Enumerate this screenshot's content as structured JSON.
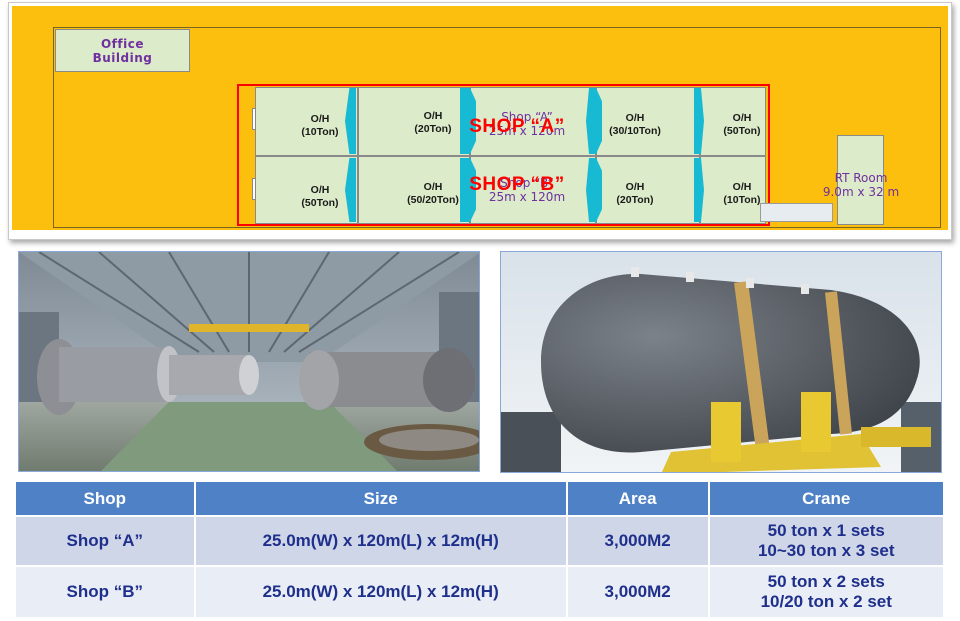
{
  "plan": {
    "office": {
      "line1": "Office",
      "line2": "Building"
    },
    "top_row": [
      {
        "line1": "O/H",
        "line2": "(10Ton)"
      },
      {
        "line1": "O/H",
        "line2": "(20Ton)"
      },
      {
        "line1": "O/H",
        "line2": "(30/10Ton)"
      },
      {
        "line1": "O/H",
        "line2": "(50Ton)"
      }
    ],
    "bottom_row": [
      {
        "line1": "O/H",
        "line2": "(50Ton)"
      },
      {
        "line1": "O/H",
        "line2": "(50/20Ton)"
      },
      {
        "line1": "O/H",
        "line2": "(20Ton)"
      },
      {
        "line1": "O/H",
        "line2": "(10Ton)"
      }
    ],
    "shop_a": {
      "label": "SHOP “A”",
      "area_line1": "Shop “A”",
      "area_line2": "25m x 120m"
    },
    "shop_b": {
      "label": "SHOP “B”",
      "area_line1": "Shop “B”",
      "area_line2": "25m x 120m"
    },
    "rt_room": {
      "line1": "RT Room",
      "line2": "9.0m x 32 m"
    },
    "colors": {
      "site": "#fdbf0d",
      "building": "#dcebc9",
      "outline": "#ff0000",
      "crane_rail": "#17b9d3",
      "label": "#7030a0"
    }
  },
  "photos": [
    {
      "icon": "factory-interior-photo"
    },
    {
      "icon": "pressure-vessel-photo"
    }
  ],
  "table": {
    "headers": [
      "Shop",
      "Size",
      "Area",
      "Crane"
    ],
    "rows": [
      {
        "shop": "Shop “A”",
        "size": "25.0m(W) x 120m(L) x 12m(H)",
        "area": "3,000M2",
        "crane1": "50 ton x 1 sets",
        "crane2": "10~30 ton x 3 set"
      },
      {
        "shop": "Shop “B”",
        "size": "25.0m(W) x 120m(L) x 12m(H)",
        "area": "3,000M2",
        "crane1": "50 ton x 2 sets",
        "crane2": "10/20 ton x 2 set"
      }
    ],
    "colors": {
      "header": "#4f81c6",
      "row1": "#cfd6e8",
      "row2": "#e9edf5",
      "text": "#1f2f8c"
    }
  }
}
